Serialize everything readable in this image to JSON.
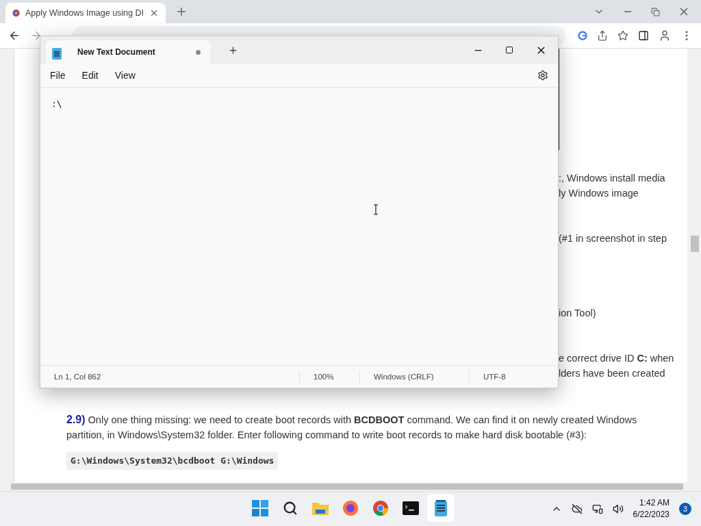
{
  "browser": {
    "tab": {
      "title": "Apply Windows Image using DI",
      "selected": true
    }
  },
  "page": {
    "fragments": [
      {
        "lines": [
          ":, Windows install media",
          "ly Windows image"
        ]
      },
      {
        "lines": [
          "(#1 in screenshot in step"
        ]
      },
      {
        "lines": [
          "ion Tool)"
        ]
      },
      {
        "lines": [
          "e correct drive ID **C:** when",
          "lders have been created"
        ]
      }
    ],
    "step": {
      "number": "2.9)",
      "text": "Only one thing missing: we need to create boot records with **BCDBOOT** command. We can find it on newly created Windows partition, in Windows\\System32 folder. Enter following command to write boot records to make hard disk bootable (#3):"
    },
    "code": "G:\\Windows\\System32\\bcdboot G:\\Windows"
  },
  "notepad": {
    "tab": {
      "title": "New Text Document",
      "unsaved": true,
      "selected": true
    },
    "menu": [
      "File",
      "Edit",
      "View"
    ],
    "content": ":\\",
    "status": [
      "Ln 1, Col 862",
      "100%",
      "Windows (CRLF)",
      "UTF-8"
    ]
  },
  "taskbar": {
    "apps": [
      {
        "kind": "start",
        "active": false
      },
      {
        "kind": "search",
        "active": false
      },
      {
        "kind": "folder",
        "active": false
      },
      {
        "kind": "firefox",
        "active": false
      },
      {
        "kind": "chrome",
        "active": false
      },
      {
        "kind": "terminal",
        "active": false
      },
      {
        "kind": "notepad",
        "active": true
      }
    ],
    "time": "1:42 AM",
    "date": "6/22/2023",
    "notifications": "3"
  }
}
